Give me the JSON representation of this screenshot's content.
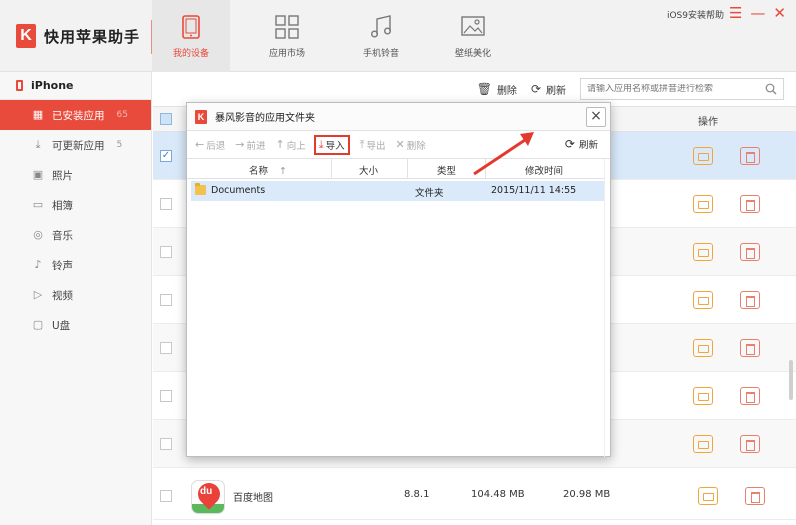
{
  "app": {
    "name": "快用苹果助手",
    "logo_letter": "K",
    "accent": "#e84a3c"
  },
  "nav_tabs": [
    {
      "label": "我的设备",
      "icon": "tablet-icon",
      "active": true
    },
    {
      "label": "应用市场",
      "icon": "grid-icon",
      "active": false
    },
    {
      "label": "手机铃音",
      "icon": "music-note-icon",
      "active": false
    },
    {
      "label": "壁纸美化",
      "icon": "image-icon",
      "active": false
    }
  ],
  "top_right": {
    "help": "iOS9安装帮助",
    "menu": "☰",
    "minimize": "—",
    "close": "✕"
  },
  "sidebar": {
    "device": "iPhone",
    "items": [
      {
        "label": "已安装应用",
        "count": "65",
        "icon": "apps-icon",
        "active": true
      },
      {
        "label": "可更新应用",
        "count": "5",
        "icon": "update-icon",
        "active": false
      },
      {
        "label": "照片",
        "count": "",
        "icon": "photo-icon",
        "active": false
      },
      {
        "label": "相簿",
        "count": "",
        "icon": "album-icon",
        "active": false
      },
      {
        "label": "音乐",
        "count": "",
        "icon": "music-icon",
        "active": false
      },
      {
        "label": "铃声",
        "count": "",
        "icon": "ringtone-icon",
        "active": false
      },
      {
        "label": "视频",
        "count": "",
        "icon": "video-icon",
        "active": false
      },
      {
        "label": "U盘",
        "count": "",
        "icon": "usb-icon",
        "active": false
      }
    ]
  },
  "toolbar": {
    "delete_label": "删除",
    "refresh_label": "刷新",
    "search_placeholder": "请输入应用名称或拼音进行检索"
  },
  "table": {
    "op_header": "操作",
    "visible_app": {
      "name": "百度地图",
      "version": "8.8.1",
      "size": "104.48 MB",
      "doc_size": "20.98 MB",
      "icon_text": "du"
    }
  },
  "dialog": {
    "title": "暴风影音的应用文件夹",
    "close": "×",
    "tools": {
      "back": "后退",
      "forward": "前进",
      "up": "向上",
      "import": "导入",
      "export": "导出",
      "delete": "删除",
      "refresh": "刷新"
    },
    "columns": {
      "name": "名称",
      "sort_indicator": "↑",
      "size": "大小",
      "type": "类型",
      "modified": "修改时间"
    },
    "rows": [
      {
        "name": "Documents",
        "size": "",
        "type": "文件夹",
        "modified": "2015/11/11 14:55"
      }
    ]
  }
}
